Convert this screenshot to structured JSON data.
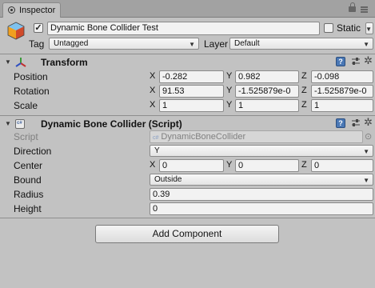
{
  "tab": {
    "label": "Inspector"
  },
  "header": {
    "object_name": "Dynamic Bone Collider Test",
    "active": true,
    "static_label": "Static",
    "static_checked": false,
    "tag_label": "Tag",
    "tag_value": "Untagged",
    "layer_label": "Layer",
    "layer_value": "Default"
  },
  "transform": {
    "title": "Transform",
    "rows": [
      {
        "label": "Position",
        "x": "-0.282",
        "y": "0.982",
        "z": "-0.098"
      },
      {
        "label": "Rotation",
        "x": "91.53",
        "y": "-1.525879e-0",
        "z": "-1.525879e-0"
      },
      {
        "label": "Scale",
        "x": "1",
        "y": "1",
        "z": "1"
      }
    ]
  },
  "axis": {
    "x": "X",
    "y": "Y",
    "z": "Z"
  },
  "collider": {
    "title": "Dynamic Bone Collider (Script)",
    "script_label": "Script",
    "script_value": "DynamicBoneCollider",
    "direction_label": "Direction",
    "direction_value": "Y",
    "center_label": "Center",
    "center": {
      "x": "0",
      "y": "0",
      "z": "0"
    },
    "bound_label": "Bound",
    "bound_value": "Outside",
    "radius_label": "Radius",
    "radius_value": "0.39",
    "height_label": "Height",
    "height_value": "0"
  },
  "add_component": {
    "label": "Add Component"
  },
  "icons": {
    "tab": "inspector-eye-icon",
    "lock": "lock-icon",
    "menu": "menu-icon",
    "cube": "gameobject-cube-icon",
    "transform": "transform-axes-icon",
    "script": "script-file-icon",
    "help": "help-book-icon",
    "preset": "preset-sliders-icon",
    "gear": "gear-icon"
  },
  "colors": {
    "background": "#c2c2c2",
    "tabbar": "#a2a2a2",
    "field": "#f2f2f2",
    "help_icon": "#4a78b5"
  }
}
